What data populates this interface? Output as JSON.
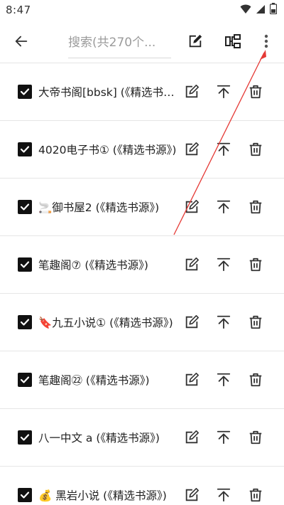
{
  "status_bar": {
    "time": "8:47"
  },
  "toolbar": {
    "search_placeholder": "搜索(共270个...",
    "back_icon": "arrow-left-icon",
    "actions": [
      "edit-square-icon",
      "group-structure-icon",
      "more-vert-icon"
    ]
  },
  "rows": [
    {
      "label": "大帝书阁[bbsk] (《精选书源》)",
      "checked": true
    },
    {
      "label": "4020电子书① (《精选书源》)",
      "checked": true
    },
    {
      "label": "🚬御书屋2 (《精选书源》)",
      "checked": true
    },
    {
      "label": "笔趣阁⑦ (《精选书源》)",
      "checked": true
    },
    {
      "label": "🔖九五小说① (《精选书源》)",
      "checked": true
    },
    {
      "label": "笔趣阁㉒ (《精选书源》)",
      "checked": true
    },
    {
      "label": "八一中文 a (《精选书源》)",
      "checked": true
    },
    {
      "label": "💰 黑岩小说 (《精选书源》)",
      "checked": true
    }
  ],
  "annotation_color": "#e53935"
}
